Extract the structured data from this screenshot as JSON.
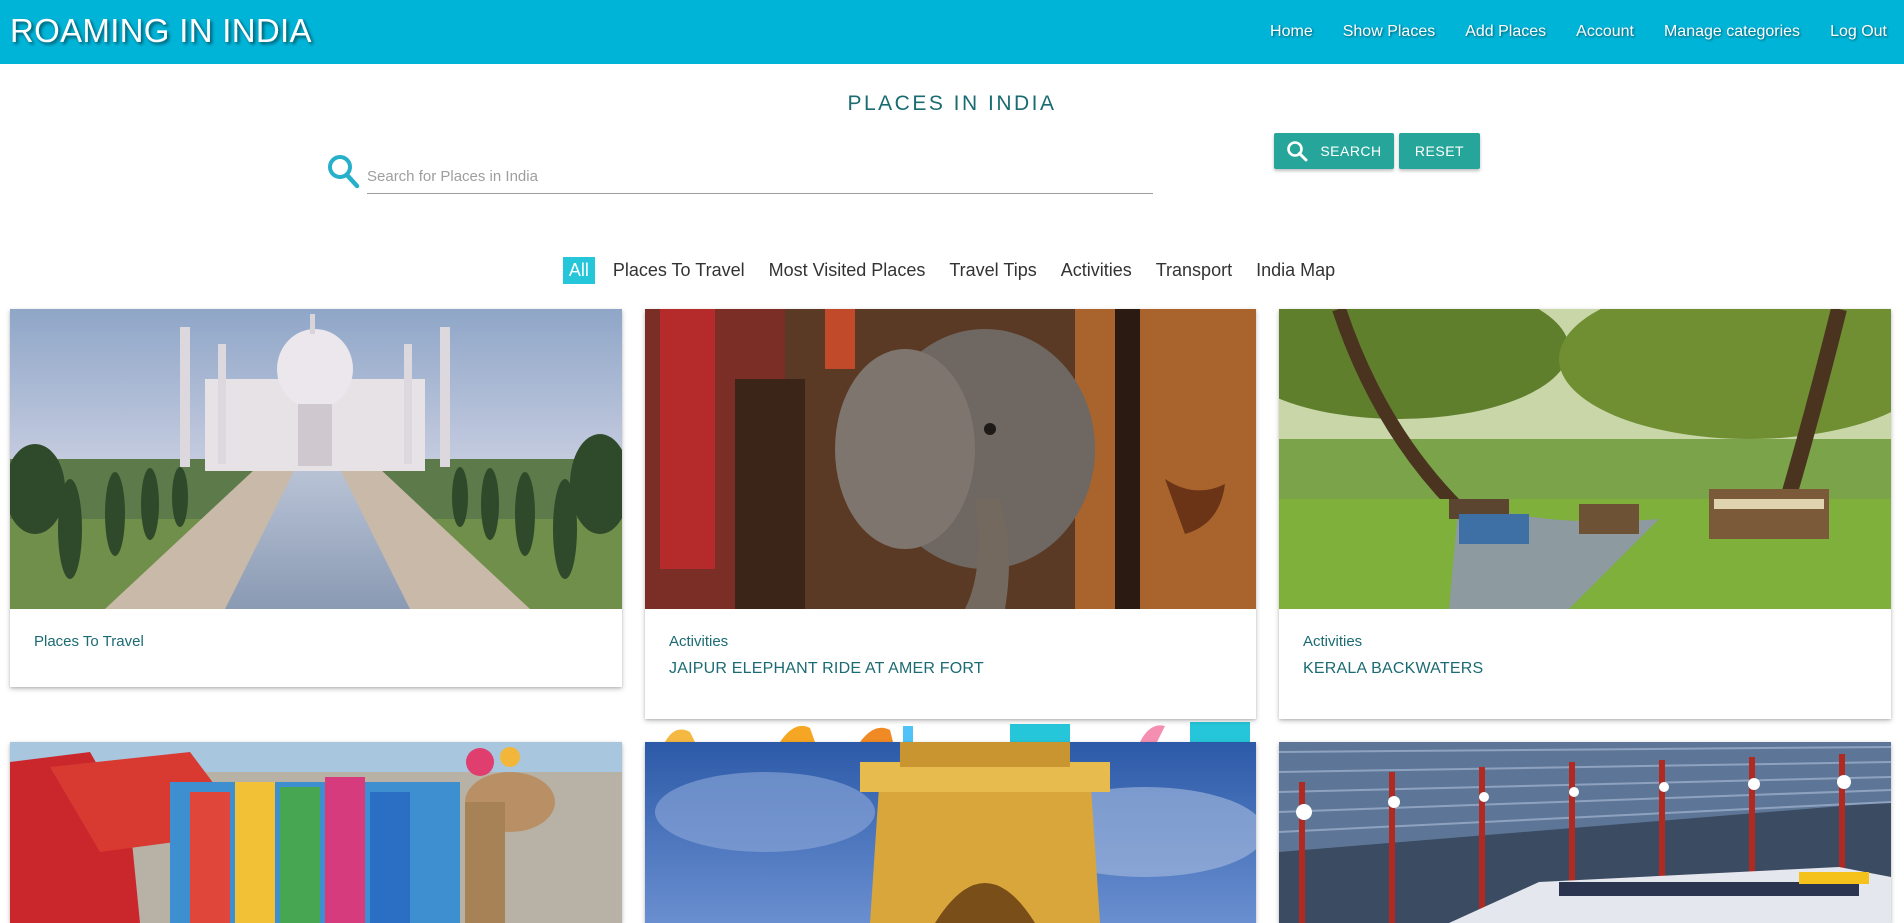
{
  "header": {
    "brand": "ROAMING IN INDIA",
    "nav": [
      "Home",
      "Show Places",
      "Add Places",
      "Account",
      "Manage categories",
      "Log Out"
    ]
  },
  "page_title": "PLACES IN INDIA",
  "search": {
    "placeholder": "Search for Places in India",
    "value": "",
    "search_label": "SEARCH",
    "reset_label": "RESET"
  },
  "filters": {
    "active": "All",
    "items": [
      "All",
      "Places To Travel",
      "Most Visited Places",
      "Travel Tips",
      "Activities",
      "Transport",
      "India Map"
    ]
  },
  "cards": [
    {
      "category": "Places To Travel",
      "title": "",
      "image": "taj-mahal"
    },
    {
      "category": "Activities",
      "title": "JAIPUR ELEPHANT RIDE AT AMER FORT",
      "image": "elephant"
    },
    {
      "category": "Activities",
      "title": "KERALA BACKWATERS",
      "image": "backwaters"
    },
    {
      "category": "",
      "title": "",
      "image": "decorated-camel"
    },
    {
      "category": "",
      "title": "",
      "image": "india-gate"
    },
    {
      "category": "",
      "title": "",
      "image": "train-station"
    }
  ],
  "colors": {
    "header": "#00b4d8",
    "accent": "#26a69a",
    "active_tab": "#26c6da",
    "card_text": "#1b6b73"
  },
  "icons": {
    "search": "search-icon"
  }
}
